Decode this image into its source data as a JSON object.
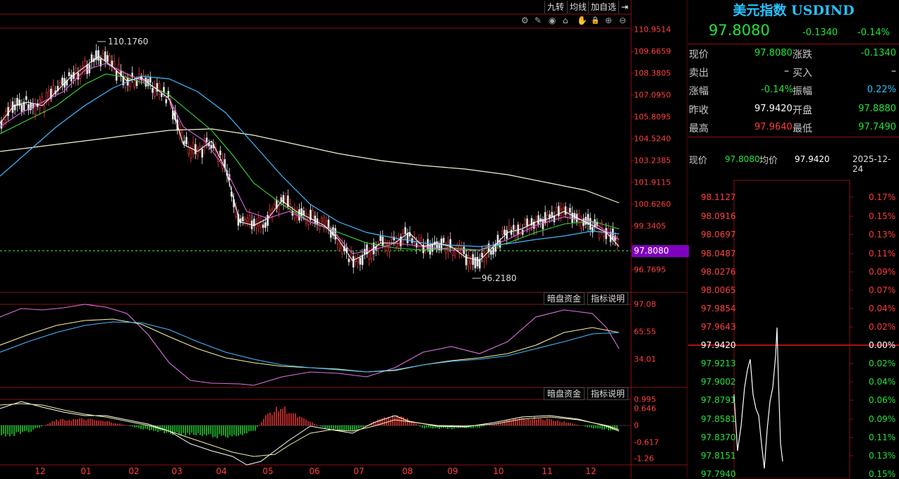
{
  "toolbar": {
    "btn1": "九转",
    "btn2": "均线",
    "btn3": "加自选",
    "btn4": "⇥"
  },
  "tools": [
    "⚙",
    "✎",
    "◉",
    "⌂",
    "✋",
    "🔒",
    "⊕",
    "⊖"
  ],
  "tool_names": [
    "settings-icon",
    "draw-icon",
    "eye-icon",
    "home-icon",
    "hand-icon",
    "lock-icon",
    "zoom-in-icon",
    "zoom-out-icon"
  ],
  "main_chart": {
    "y_ticks": [
      "110.9514",
      "109.6659",
      "108.3805",
      "107.0950",
      "105.8095",
      "104.5240",
      "103.2385",
      "101.9115",
      "100.6260",
      "99.3405",
      "96.7695"
    ],
    "current_tag": "97.8080",
    "max_label": "110.1760",
    "min_label": "96.2180"
  },
  "panel2": {
    "tag1": "暗盘资金",
    "tag2": "指标说明",
    "y_ticks": [
      "97.08",
      "65.55",
      "34.01"
    ]
  },
  "panel3": {
    "tag1": "暗盘资金",
    "tag2": "指标说明",
    "y_ticks": [
      "0.995",
      "0.646",
      "0",
      "-0.617",
      "-1.26"
    ]
  },
  "x_ticks": [
    "12",
    "01",
    "02",
    "03",
    "04",
    "05",
    "06",
    "07",
    "08",
    "09",
    "10",
    "11",
    "12"
  ],
  "quote": {
    "title": "美元指数 USDIND",
    "price": "97.8080",
    "change": "-0.1340",
    "change_pct": "-0.14%",
    "rows": [
      {
        "l1": "现价",
        "v1": "97.8080",
        "c1": "green",
        "l2": "涨跌",
        "v2": "-0.1340",
        "c2": "green"
      },
      {
        "l1": "卖出",
        "v1": "–",
        "c1": "white",
        "l2": "买入",
        "v2": "–",
        "c2": "white"
      },
      {
        "l1": "涨幅",
        "v1": "-0.14%",
        "c1": "green",
        "l2": "振幅",
        "v2": "0.22%",
        "c2": "cyan"
      },
      {
        "l1": "昨收",
        "v1": "97.9420",
        "c1": "white",
        "l2": "开盘",
        "v2": "97.8880",
        "c2": "green"
      },
      {
        "l1": "最高",
        "v1": "97.9640",
        "c1": "red",
        "l2": "最低",
        "v2": "97.7490",
        "c2": "green"
      }
    ]
  },
  "minute": {
    "label_price": "现价",
    "price": "97.8080",
    "label_avg": "均价",
    "avg": "97.9420",
    "date": "2025-12-24",
    "left_ticks": [
      "98.1127",
      "98.0916",
      "98.0697",
      "98.0487",
      "98.0276",
      "98.0065",
      "97.9854",
      "97.9643",
      "97.9420",
      "97.9213",
      "97.9002",
      "97.8791",
      "97.8581",
      "97.8370",
      "97.8151",
      "97.7940"
    ],
    "right_ticks": [
      "0.17%",
      "0.15%",
      "0.13%",
      "0.11%",
      "0.09%",
      "0.07%",
      "0.04%",
      "0.02%",
      "0.00%",
      "0.02%",
      "0.04%",
      "0.06%",
      "0.09%",
      "0.11%",
      "0.13%",
      "0.15%"
    ]
  },
  "colors": {
    "up": "#ff3b3b",
    "down": "#22e33a",
    "grid": "#8b1010",
    "accent": "#27c3ff"
  }
}
